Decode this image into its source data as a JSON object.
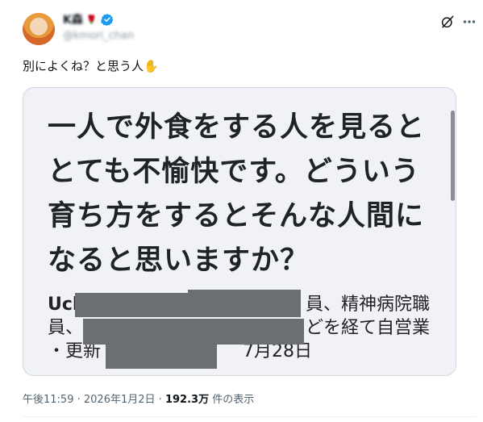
{
  "author": {
    "display_name": "K森",
    "name_emoji": "🌹",
    "handle": "@kmori_chan"
  },
  "tweet": {
    "text": "別によくね？と思う人",
    "emoji": "✋"
  },
  "card": {
    "headline_lines": [
      "一人で外食をする人を見ると",
      "とても不愉快です。どういう",
      "育ち方をするとそんな人間に",
      "なると思いますか？"
    ],
    "sub_lines": [
      "Ucl",
      "員、精神病院職",
      "員、",
      "どを経て自営業",
      "・更新",
      "7月28日"
    ]
  },
  "meta": {
    "time": "午後11:59",
    "dot1": "·",
    "date": "2026年1月2日",
    "dot2": "·",
    "views": "192.3万",
    "views_label": "件の表示"
  },
  "colors": {
    "verified": "#1d9bf0",
    "card_bg": "#f0f2f8",
    "redaction": "#6b6e73",
    "meta_text": "#536471"
  }
}
